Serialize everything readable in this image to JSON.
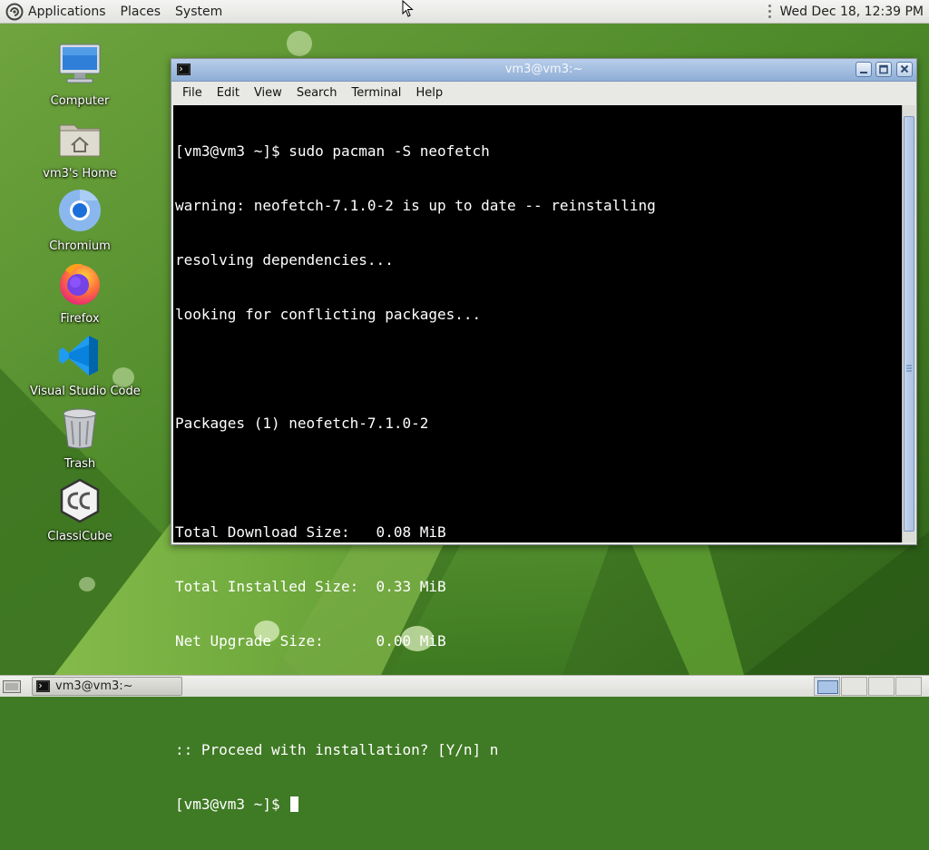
{
  "top_panel": {
    "menus": [
      "Applications",
      "Places",
      "System"
    ],
    "clock": "Wed Dec 18, 12:39 PM"
  },
  "desktop_icons": [
    {
      "label": "Computer",
      "icon": "computer-icon"
    },
    {
      "label": "vm3's Home",
      "icon": "home-folder-icon"
    },
    {
      "label": "Chromium",
      "icon": "chromium-icon"
    },
    {
      "label": "Firefox",
      "icon": "firefox-icon"
    },
    {
      "label": "Visual Studio Code",
      "icon": "vscode-icon"
    },
    {
      "label": "Trash",
      "icon": "trash-icon"
    },
    {
      "label": "ClassiCube",
      "icon": "classicube-icon"
    }
  ],
  "window": {
    "title": "vm3@vm3:~",
    "menu": [
      "File",
      "Edit",
      "View",
      "Search",
      "Terminal",
      "Help"
    ]
  },
  "terminal": {
    "lines": [
      "[vm3@vm3 ~]$ sudo pacman -S neofetch",
      "warning: neofetch-7.1.0-2 is up to date -- reinstalling",
      "resolving dependencies...",
      "looking for conflicting packages...",
      "",
      "Packages (1) neofetch-7.1.0-2",
      "",
      "Total Download Size:   0.08 MiB",
      "Total Installed Size:  0.33 MiB",
      "Net Upgrade Size:      0.00 MiB",
      "",
      ":: Proceed with installation? [Y/n] n"
    ],
    "prompt": "[vm3@vm3 ~]$ "
  },
  "taskbar": {
    "task_label": "vm3@vm3:~"
  },
  "colors": {
    "terminal_bg": "#000000",
    "terminal_fg": "#ffffff",
    "titlebar_accent": "#8eaed6"
  }
}
